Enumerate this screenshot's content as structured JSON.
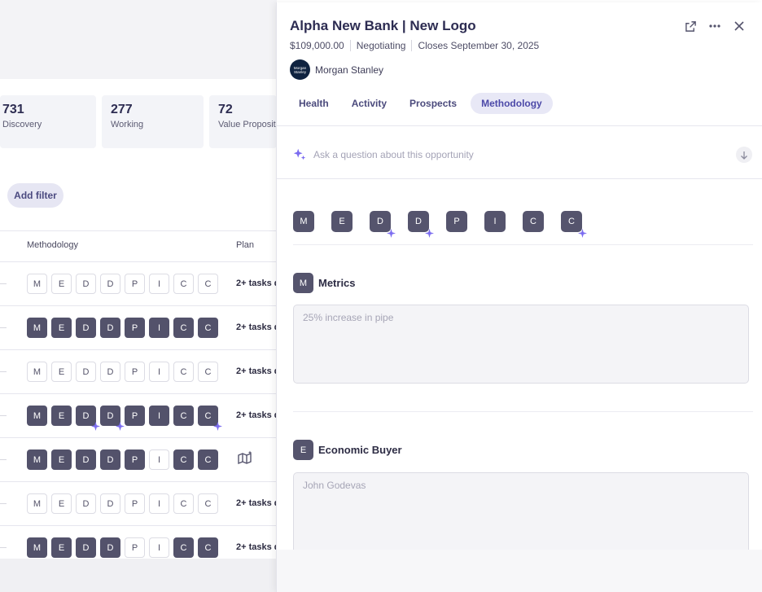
{
  "stats": [
    {
      "value": "731",
      "label": "Discovery"
    },
    {
      "value": "277",
      "label": "Working"
    },
    {
      "value": "72",
      "label": "Value Proposit"
    }
  ],
  "filters": {
    "add_label": "Add filter"
  },
  "table": {
    "headers": {
      "methodology": "Methodology",
      "plan": "Plan"
    },
    "letters": [
      "M",
      "E",
      "D",
      "D",
      "P",
      "I",
      "C",
      "C"
    ],
    "rows": [
      {
        "plan": "2+ tasks d"
      },
      {
        "plan": "2+ tasks d"
      },
      {
        "plan": "2+ tasks d"
      },
      {
        "plan": "2+ tasks d"
      },
      {
        "plan": ""
      },
      {
        "plan": "2+ tasks d"
      },
      {
        "plan": "2+ tasks d"
      }
    ]
  },
  "opportunity": {
    "title": "Alpha New Bank | New Logo",
    "amount": "$109,000.00",
    "stage": "Negotiating",
    "closes": "Closes September 30, 2025",
    "account": "Morgan Stanley",
    "logo_text": "Morgan Stanley"
  },
  "tabs": [
    {
      "label": "Health"
    },
    {
      "label": "Activity"
    },
    {
      "label": "Prospects"
    },
    {
      "label": "Methodology",
      "active": true
    }
  ],
  "ask": {
    "placeholder": "Ask a question about this opportunity"
  },
  "methodology": {
    "letters": [
      "M",
      "E",
      "D",
      "D",
      "P",
      "I",
      "C",
      "C"
    ],
    "sections": [
      {
        "letter": "M",
        "title": "Metrics",
        "value": "25% increase in pipe"
      },
      {
        "letter": "E",
        "title": "Economic Buyer",
        "value": "John Godevas"
      }
    ]
  },
  "icons": {
    "open_external": "open-external-icon",
    "more": "more-icon",
    "close": "close-icon",
    "sparkle": "sparkle-icon",
    "arrow_down": "arrow-down-icon",
    "map": "map-sparkle-icon"
  },
  "colors": {
    "accent": "#4c49a8",
    "chip_filled": "#53526b",
    "ai_spark": "#7b6cf0"
  }
}
